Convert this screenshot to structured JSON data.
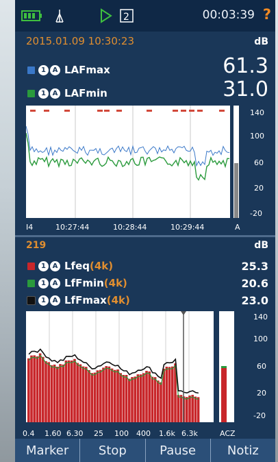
{
  "status": {
    "time": "00:03:39",
    "help_glyph": "?",
    "channel_number": "2",
    "icons": [
      "battery-icon",
      "antenna-icon",
      "play-icon",
      "channel-icon",
      "help-icon"
    ]
  },
  "top_panel": {
    "datetime": "2015.01.09 10:30:23",
    "unit": "dB",
    "rows": [
      {
        "label": "LAFmax",
        "value": "61.3",
        "color": "#3a78c8"
      },
      {
        "label": "LAFmin",
        "value": "31.0",
        "color": "#2a9a3c"
      }
    ],
    "y_ticks": [
      "140",
      "100",
      "60",
      "20",
      "-20"
    ],
    "x_ticks": [
      "I4",
      "10:27:44",
      "10:28:44",
      "10:29:44",
      "A"
    ]
  },
  "bottom_panel": {
    "count": "219",
    "unit": "dB",
    "rows": [
      {
        "label": "Lfeq",
        "suffix": "(4k)",
        "value": "25.3",
        "color": "#c8262a"
      },
      {
        "label": "LfFmin",
        "suffix": "(4k)",
        "value": "20.6",
        "color": "#2a9a3c"
      },
      {
        "label": "LfFmax",
        "suffix": "(4k)",
        "value": "23.0",
        "color": "#111111"
      }
    ],
    "y_ticks": [
      "140",
      "100",
      "60",
      "20",
      "-20"
    ],
    "x_ticks": [
      "0.4",
      "1.60",
      "6.30",
      "25",
      "100",
      "400",
      "1.6k",
      "6.3k",
      "ACZ"
    ]
  },
  "buttons": [
    "Marker",
    "Stop",
    "Pause",
    "Notiz"
  ],
  "colors": {
    "background": "#173152",
    "accent": "#e08e30",
    "maxline": "#3a78c8",
    "minline": "#2a9a3c",
    "bars": "#c8262a"
  }
}
